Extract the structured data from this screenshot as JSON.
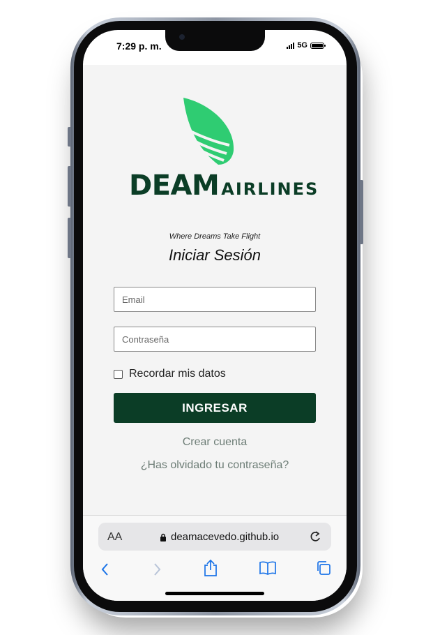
{
  "status_bar": {
    "time": "7:29 p. m.",
    "network": "5G"
  },
  "logo": {
    "brand_primary": "DEAM",
    "brand_secondary": "AIRLINES",
    "tagline": "Where Dreams Take Flight",
    "wing_color": "#2fcc72",
    "text_color": "#0b3d26"
  },
  "login": {
    "title": "Iniciar Sesión",
    "email_placeholder": "Email",
    "password_placeholder": "Contraseña",
    "remember_label": "Recordar mis datos",
    "submit_label": "INGRESAR",
    "submit_color": "#0b3d26",
    "create_account_label": "Crear cuenta",
    "forgot_password_label": "¿Has olvidado tu contraseña?"
  },
  "browser": {
    "text_size_label": "AA",
    "url": "deamacevedo.github.io",
    "toolbar_icons": [
      "back-icon",
      "forward-icon",
      "share-icon",
      "bookmarks-icon",
      "tabs-icon"
    ]
  }
}
